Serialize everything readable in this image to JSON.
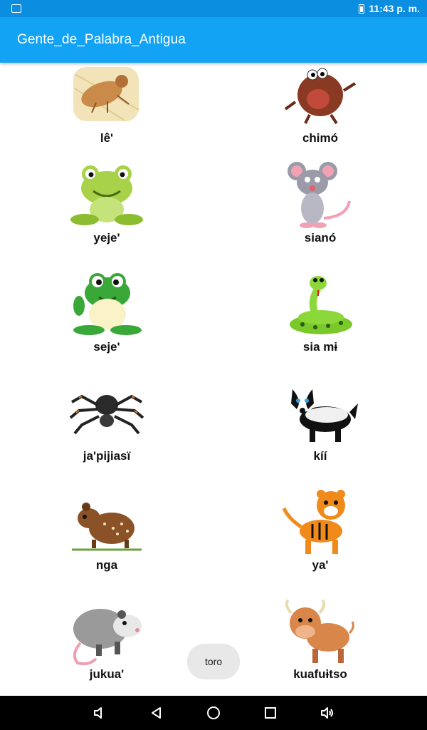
{
  "status_bar": {
    "time": "11:43 p. m."
  },
  "app_bar": {
    "title": "Gente_de_Palabra_Antigua"
  },
  "animals": [
    {
      "label": "lê'",
      "icon": "cicada-larva-icon"
    },
    {
      "label": "chimó",
      "icon": "cockroach-icon"
    },
    {
      "label": "yeje'",
      "icon": "green-frog-icon"
    },
    {
      "label": "sianó",
      "icon": "mouse-icon"
    },
    {
      "label": "seje'",
      "icon": "waving-frog-icon"
    },
    {
      "label": "sia mɨ",
      "icon": "snake-icon"
    },
    {
      "label": "ja'pijiasï",
      "icon": "spider-icon"
    },
    {
      "label": "kíí",
      "icon": "badger-icon"
    },
    {
      "label": "nga",
      "icon": "paca-icon"
    },
    {
      "label": "ya'",
      "icon": "tiger-icon"
    },
    {
      "label": "jukua'",
      "icon": "opossum-icon"
    },
    {
      "label": "kuafuɨtso",
      "icon": "bull-icon"
    }
  ],
  "toast": {
    "text": "toro"
  },
  "colors": {
    "status_bar": "#0b8ee0",
    "app_bar": "#12a3f5",
    "nav_bar": "#000000"
  }
}
